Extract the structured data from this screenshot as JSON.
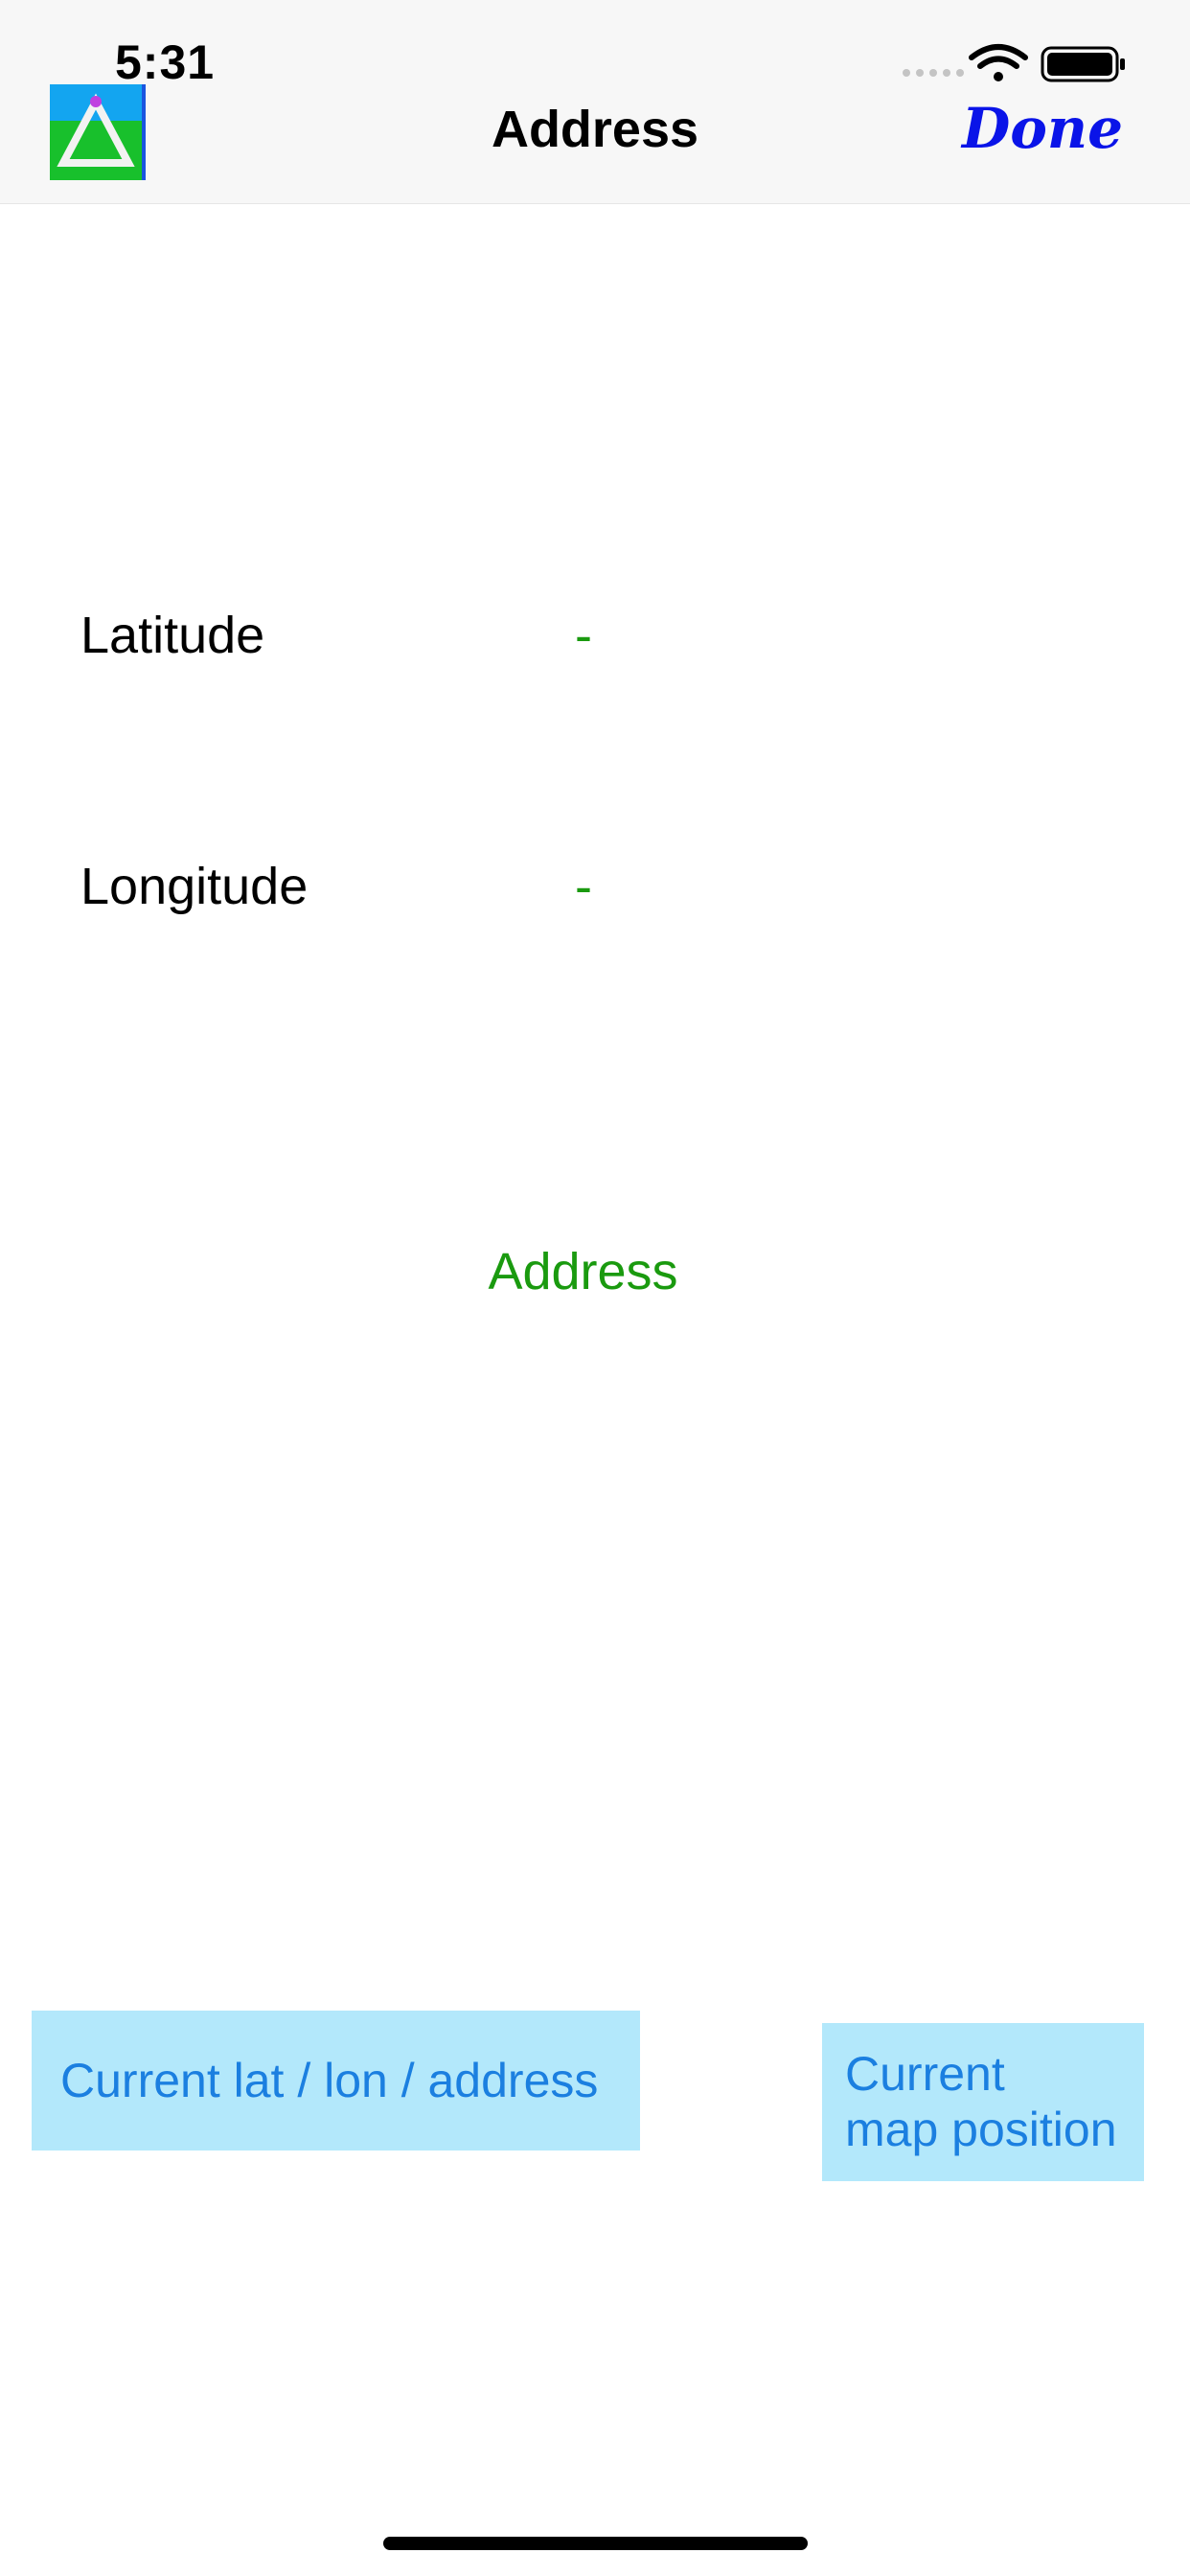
{
  "status_bar": {
    "time": "5:31",
    "icons": [
      "signal-dots-icon",
      "wifi-icon",
      "battery-icon"
    ]
  },
  "nav": {
    "title": "Address",
    "done_label": "Done",
    "app_icon": "triangle-app-icon"
  },
  "fields": {
    "latitude_label": "Latitude",
    "latitude_value": "-",
    "longitude_label": "Longitude",
    "longitude_value": "-"
  },
  "address": {
    "text": "Address"
  },
  "buttons": {
    "current_label": "Current lat / lon / address",
    "map_label_line1": "Current",
    "map_label_line2": "map position"
  },
  "colors": {
    "done": "#0a14e8",
    "value_green": "#1a9a0f",
    "button_bg": "#b3e8fb",
    "button_text": "#1b7fe0"
  }
}
